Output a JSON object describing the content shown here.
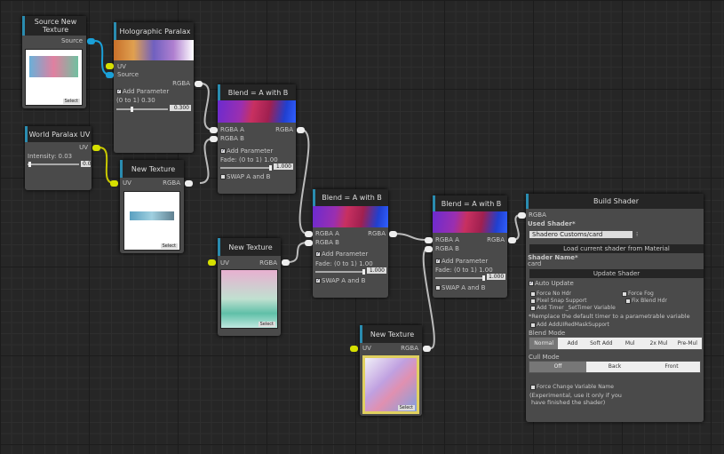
{
  "nodes": {
    "source_tex": {
      "title": "Source New Texture",
      "out": "Source",
      "select": "Select"
    },
    "holo": {
      "title": "Holographic Paralax",
      "in_uv": "UV",
      "in_source": "Source",
      "out": "RGBA",
      "add_param": "Add Parameter",
      "range": "(0 to 1) 0.30",
      "value": "0.300",
      "slider": 0.3
    },
    "world_uv": {
      "title": "World Paralax UV",
      "out": "UV",
      "intensity": "Intensity: 0.03",
      "value": "0.0",
      "slider": 0.03
    },
    "tex1": {
      "title": "New Texture",
      "in": "UV",
      "out": "RGBA",
      "select": "Select"
    },
    "tex2": {
      "title": "New Texture",
      "in": "UV",
      "out": "RGBA",
      "select": "Select"
    },
    "tex3": {
      "title": "New Texture",
      "in": "UV",
      "out": "RGBA",
      "select": "Select"
    },
    "blend1": {
      "title": "Blend = A with B",
      "in_a": "RGBA A",
      "in_b": "RGBA B",
      "out": "RGBA",
      "add_param": "Add Parameter",
      "fade": "Fade: (0 to 1) 1.00",
      "value": "1.000",
      "swap": "SWAP A and B",
      "swap_checked": false
    },
    "blend2": {
      "title": "Blend = A with B",
      "in_a": "RGBA A",
      "in_b": "RGBA B",
      "out": "RGBA",
      "add_param": "Add Parameter",
      "fade": "Fade: (0 to 1) 1.00",
      "value": "1.000",
      "swap": "SWAP A and B",
      "swap_checked": true
    },
    "blend3": {
      "title": "Blend = A with B",
      "in_a": "RGBA A",
      "in_b": "RGBA B",
      "out": "RGBA",
      "add_param": "Add Parameter",
      "fade": "Fade: (0 to 1) 1.00",
      "value": "1.000",
      "swap": "SWAP A and B",
      "swap_checked": false
    }
  },
  "build": {
    "title": "Build Shader",
    "in": "RGBA",
    "used_shader_label": "Used Shader*",
    "used_shader": "Shadero Customs/card",
    "load_btn": "Load current shader from Material",
    "shader_name_label": "Shader Name*",
    "shader_name": "card",
    "update_btn": "Update Shader",
    "auto_update": "Auto Update",
    "force_no_hdr": "Force No Hdr",
    "force_fog": "Force Fog",
    "pixel_snap": "Pixel Snap Support",
    "fix_blend_hdr": "Fix Blend Hdr",
    "add_timer": "Add Timer _SetTimer Variable",
    "timer_note": "*Remplace the default timer to a parametrable variable",
    "add_mask": "Add AddUIRedMaskSupport",
    "blend_mode_label": "Blend Mode",
    "blend_modes": [
      "Normal",
      "Add",
      "Soft Add",
      "Mul",
      "2x Mul",
      "Pre-Mul"
    ],
    "blend_selected": "Normal",
    "cull_mode_label": "Cull Mode",
    "cull_modes": [
      "Off",
      "Back",
      "Front"
    ],
    "cull_selected": "Off",
    "force_change": "Force Change Variable Name",
    "note1": "(Experimental, use it only if you",
    "note2": "have finished the shader)"
  },
  "colors": {
    "uv_port": "#d6e000",
    "source_port": "#1aa0d8",
    "rgba_port": "#eeeeee",
    "accent": "#2a8cb0"
  }
}
